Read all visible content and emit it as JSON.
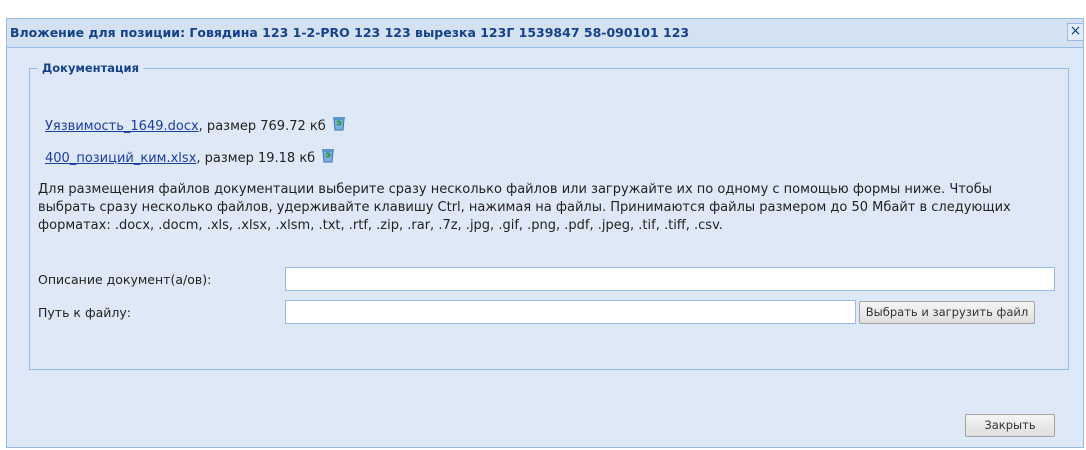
{
  "dialog": {
    "title": "Вложение для позиции: Говядина 123 1-2-PRO 123 123 вырезка 123Г 1539847 58-090101 123",
    "close_glyph": "×"
  },
  "documentation": {
    "legend": "Документация",
    "files": [
      {
        "name": "Уязвимость_1649.docx",
        "size_text": ", размер 769.72 кб"
      },
      {
        "name": "400_позиций_ким.xlsx",
        "size_text": ", размер 19.18 кб"
      }
    ],
    "info_text": "Для размещения файлов документации выберите сразу несколько файлов или загружайте их по одному с помощью формы ниже. Чтобы выбрать сразу несколько файлов, удерживайте клавишу Ctrl, нажимая на файлы. Принимаются файлы размером до 50 Мбайт в следующих форматах: .docx, .docm, .xls, .xlsx, .xlsm, .txt, .rtf, .zip, .rar, .7z, .jpg, .gif, .png, .pdf, .jpeg, .tif, .tiff, .csv.",
    "description_label": "Описание документ(а/ов):",
    "description_value": "",
    "path_label": "Путь к файлу:",
    "path_value": "",
    "upload_button": "Выбрать и загрузить файл"
  },
  "footer": {
    "close_button": "Закрыть"
  },
  "colors": {
    "panel_bg": "#dfe8f6",
    "border": "#99bbe8",
    "title_text": "#15428b",
    "link": "#1a3e9e"
  },
  "icons": {
    "delete": "recycle-bin-icon",
    "close": "close-icon"
  }
}
